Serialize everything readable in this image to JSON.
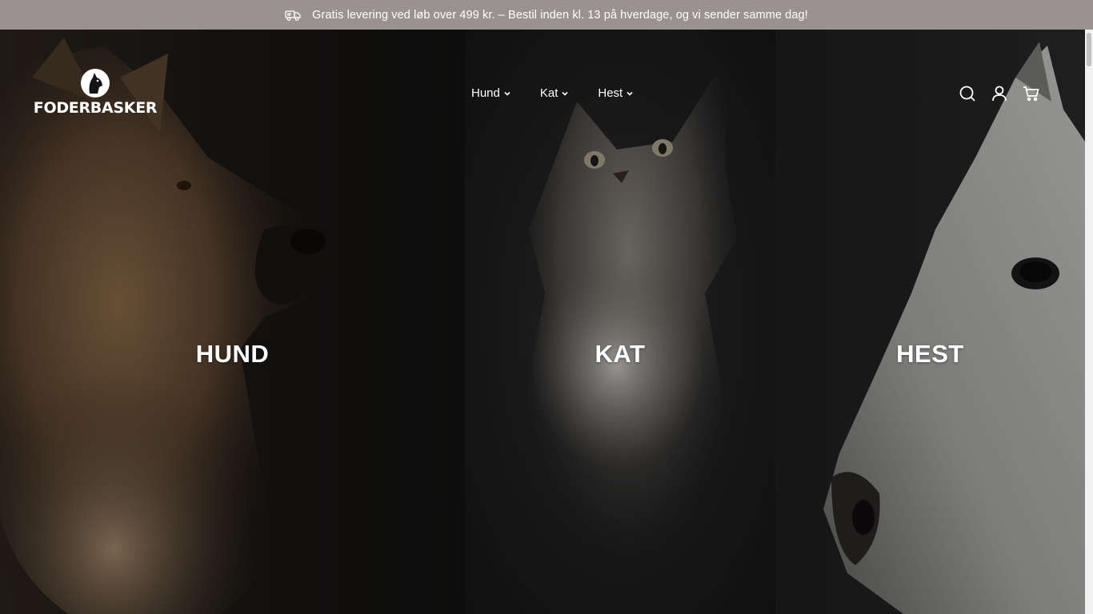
{
  "announcement": {
    "icon": "delivery-truck-icon",
    "text": "Gratis levering ved løb over 499 kr. – Bestil inden kl. 13 på hverdage, og vi sender samme dag!"
  },
  "header": {
    "logo_text": "FODERBASKER",
    "nav": [
      {
        "label": "Hund",
        "icon": "chevron-down-icon"
      },
      {
        "label": "Kat",
        "icon": "chevron-down-icon"
      },
      {
        "label": "Hest",
        "icon": "chevron-down-icon"
      }
    ],
    "icons": [
      "search-icon",
      "account-icon",
      "cart-icon"
    ]
  },
  "hero": {
    "panels": [
      {
        "title": "HUND",
        "image": "dog-photo"
      },
      {
        "title": "KAT",
        "image": "cat-photo"
      },
      {
        "title": "HEST",
        "image": "horse-photo"
      }
    ]
  },
  "colors": {
    "announcement_bg": "#999290",
    "text": "#ffffff",
    "page_bg": "#141414"
  }
}
